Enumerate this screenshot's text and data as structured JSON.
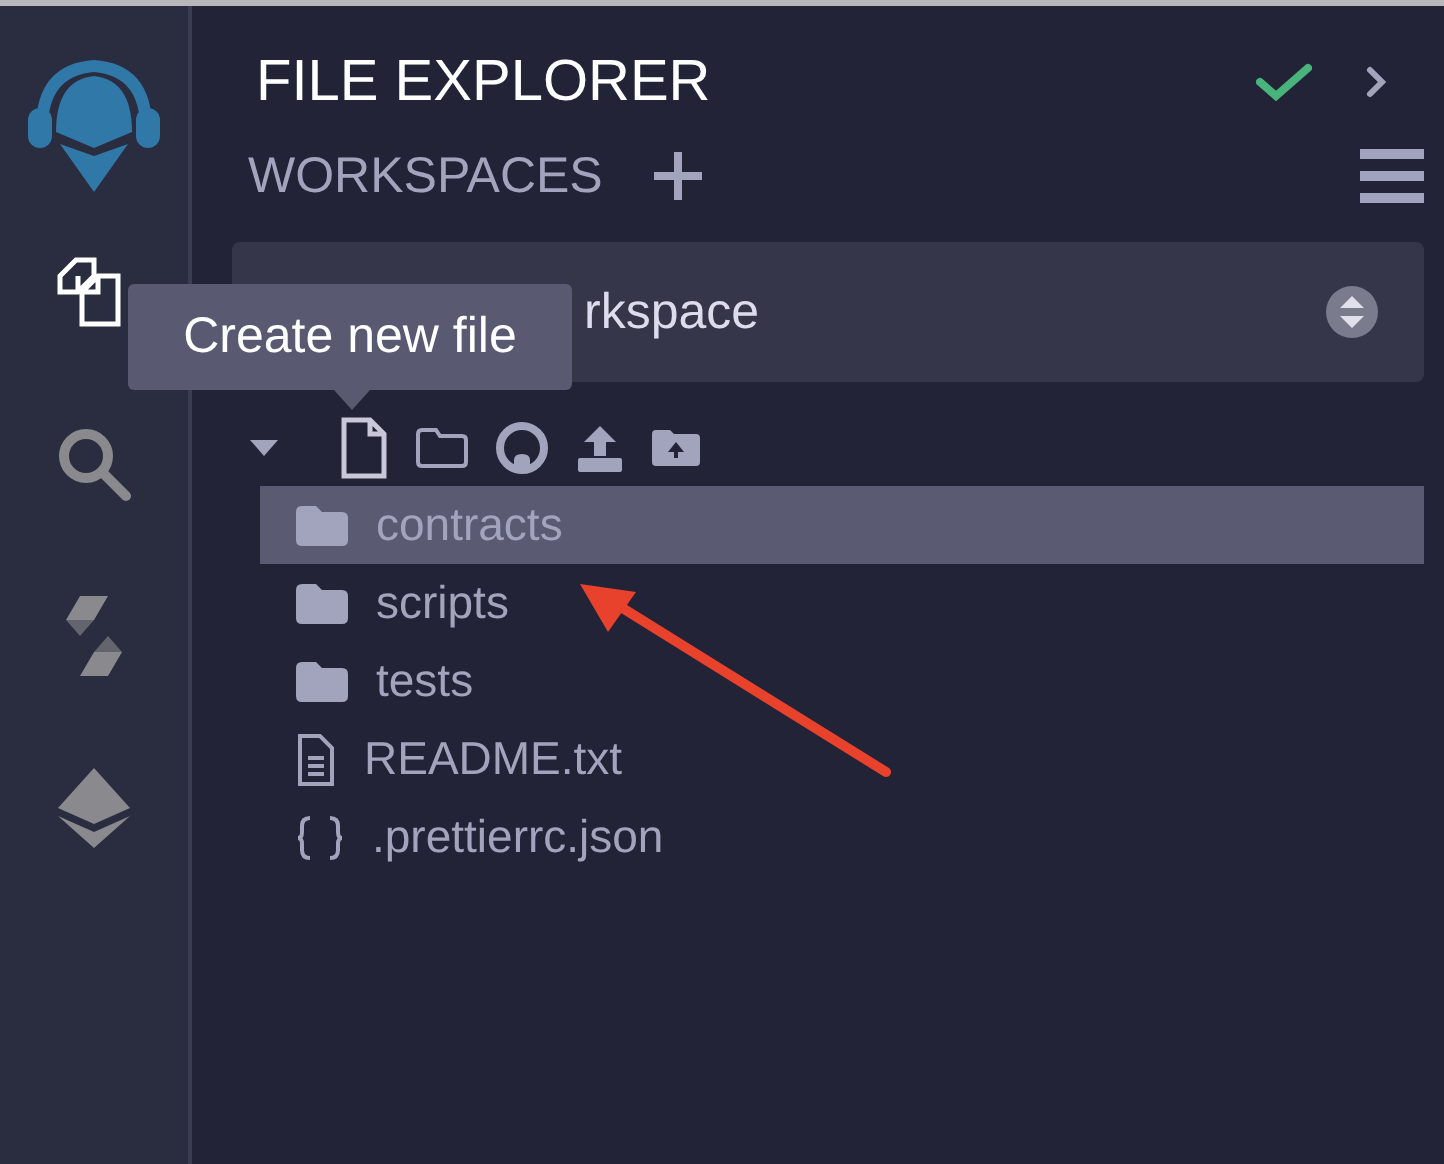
{
  "sidebar": {
    "items": [
      {
        "kind": "files",
        "selected": true
      },
      {
        "kind": "search",
        "selected": false
      },
      {
        "kind": "solidity",
        "selected": false
      },
      {
        "kind": "ethereum",
        "selected": false
      }
    ]
  },
  "panel": {
    "title": "FILE EXPLORER",
    "workspaces_label": "WORKSPACES",
    "workspace_select": {
      "value": "rkspace"
    }
  },
  "tooltip": {
    "text": "Create new file"
  },
  "tree": {
    "expanded": true,
    "items": [
      {
        "kind": "folder",
        "name": "contracts",
        "selected": true
      },
      {
        "kind": "folder",
        "name": "scripts",
        "selected": false
      },
      {
        "kind": "folder",
        "name": "tests",
        "selected": false
      },
      {
        "kind": "file",
        "name": "README.txt",
        "selected": false
      },
      {
        "kind": "json",
        "name": ".prettierrc.json",
        "selected": false
      }
    ]
  }
}
